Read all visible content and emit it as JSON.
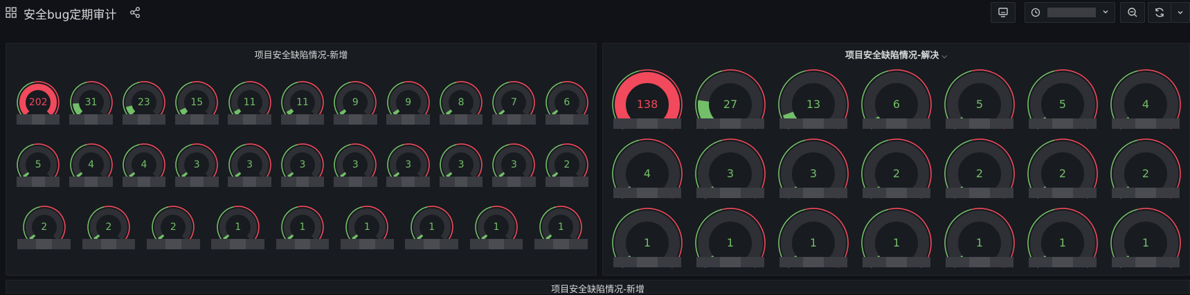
{
  "header": {
    "title": "安全bug定期审计",
    "time_range_label": "",
    "icons": {
      "dashboards": "grid-icon",
      "share": "share-icon",
      "tv_mode": "monitor-icon",
      "time_picker": "clock-icon",
      "zoom_out": "zoom-out-icon",
      "refresh": "refresh-icon",
      "refresh_menu": "chevron-down-icon"
    }
  },
  "colors": {
    "background": "#111217",
    "panel": "#181b1f",
    "gauge_red": "#f2495c",
    "gauge_green": "#73bf69",
    "gauge_track": "#2f3035"
  },
  "panels": [
    {
      "title": "项目安全缺陷情况-新增",
      "rows": [
        [
          "202",
          "31",
          "23",
          "15",
          "11",
          "11",
          "9",
          "9",
          "8",
          "7",
          "6"
        ],
        [
          "5",
          "4",
          "4",
          "3",
          "3",
          "3",
          "3",
          "3",
          "3",
          "3",
          "2"
        ],
        [
          "2",
          "2",
          "2",
          "1",
          "1",
          "1",
          "1",
          "1",
          "1"
        ]
      ]
    },
    {
      "title": "项目安全缺陷情况-解决",
      "rows": [
        [
          "138",
          "27",
          "13",
          "6",
          "5",
          "5",
          "4"
        ],
        [
          "4",
          "3",
          "3",
          "2",
          "2",
          "2",
          "2"
        ],
        [
          "1",
          "1",
          "1",
          "1",
          "1",
          "1",
          "1"
        ]
      ]
    },
    {
      "title": "项目安全缺陷情况-新增"
    }
  ],
  "gauge_data": {
    "new_values": [
      202,
      31,
      23,
      15,
      11,
      11,
      9,
      9,
      8,
      7,
      6,
      5,
      4,
      4,
      3,
      3,
      3,
      3,
      3,
      3,
      3,
      2,
      2,
      2,
      2,
      1,
      1,
      1,
      1,
      1,
      1
    ],
    "resolved_values": [
      138,
      27,
      13,
      6,
      5,
      5,
      4,
      4,
      3,
      3,
      2,
      2,
      2,
      2,
      1,
      1,
      1,
      1,
      1,
      1,
      1
    ]
  }
}
